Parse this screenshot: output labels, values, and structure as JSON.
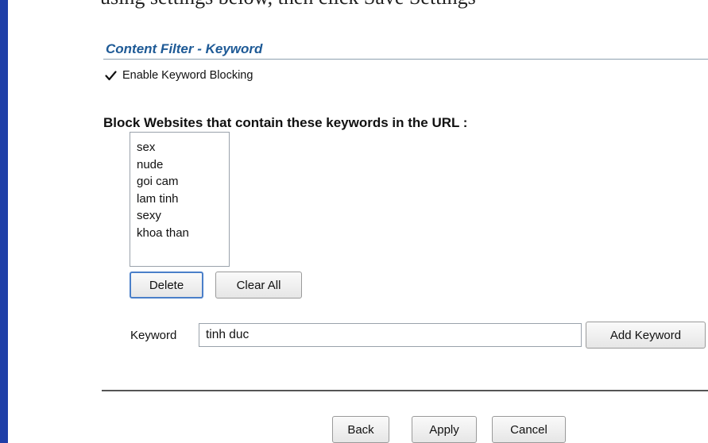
{
  "top_text": "using settings below, then click Save Settings",
  "section_title": "Content Filter - Keyword",
  "enable_checkbox": {
    "label": "Enable Keyword Blocking",
    "checked": true
  },
  "block_heading": "Block Websites that contain these keywords in the URL :",
  "keywords": [
    "sex",
    "nude",
    "goi cam",
    "lam tinh",
    "sexy",
    "khoa than"
  ],
  "buttons": {
    "delete": "Delete",
    "clear_all": "Clear All",
    "add_keyword": "Add Keyword",
    "back": "Back",
    "apply": "Apply",
    "cancel": "Cancel"
  },
  "keyword_field": {
    "label": "Keyword",
    "value": "tinh duc"
  },
  "colors": {
    "title": "#1e5a96",
    "frame": "#1f3fa8",
    "focus": "#4a7fc9"
  }
}
